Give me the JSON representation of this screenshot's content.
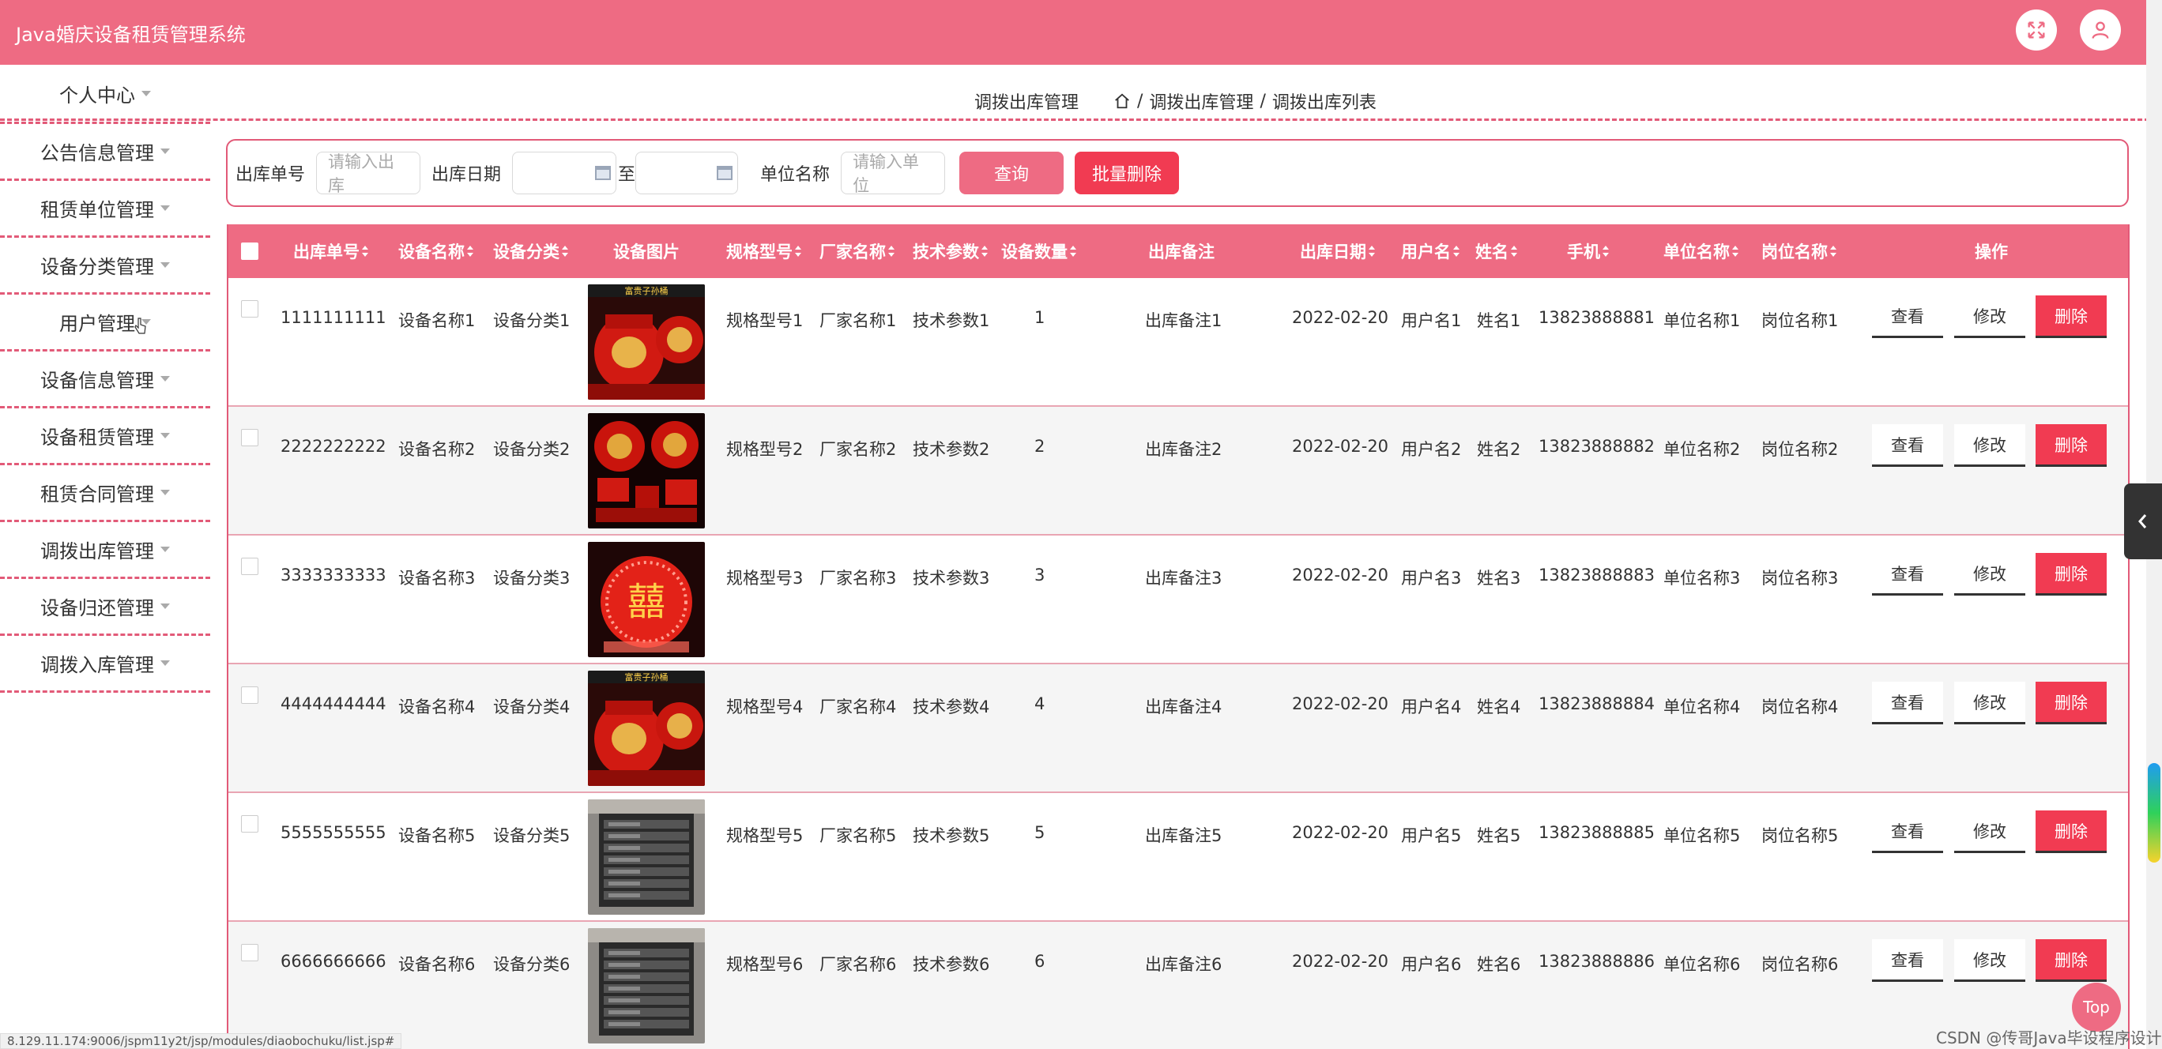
{
  "app": {
    "title": "Java婚庆设备租赁管理系统"
  },
  "sidebar": {
    "items": [
      {
        "label": "个人中心"
      },
      {
        "label": "公告信息管理"
      },
      {
        "label": "租赁单位管理"
      },
      {
        "label": "设备分类管理"
      },
      {
        "label": "用户管理"
      },
      {
        "label": "设备信息管理"
      },
      {
        "label": "设备租赁管理"
      },
      {
        "label": "租赁合同管理"
      },
      {
        "label": "调拨出库管理"
      },
      {
        "label": "设备归还管理"
      },
      {
        "label": "调拨入库管理"
      }
    ]
  },
  "breadcrumb": {
    "title": "调拨出库管理",
    "path": [
      "调拨出库管理",
      "调拨出库列表"
    ],
    "separator": "/"
  },
  "search": {
    "order_label": "出库单号",
    "order_placeholder": "请输入出库",
    "date_label": "出库日期",
    "date_to": "至",
    "unit_label": "单位名称",
    "unit_placeholder": "请输入单位",
    "query_button": "查询",
    "batch_delete_button": "批量删除"
  },
  "table": {
    "headers": {
      "order_no": "出库单号",
      "device_name": "设备名称",
      "device_category": "设备分类",
      "image": "设备图片",
      "spec": "规格型号",
      "manufacturer": "厂家名称",
      "tech_params": "技术参数",
      "quantity": "设备数量",
      "remark": "出库备注",
      "date": "出库日期",
      "username": "用户名",
      "name": "姓名",
      "phone": "手机",
      "unit": "单位名称",
      "position": "岗位名称",
      "actions": "操作"
    },
    "action_labels": {
      "view": "查看",
      "edit": "修改",
      "delete": "删除"
    },
    "rows": [
      {
        "order_no": "1111111111",
        "device_name": "设备名称1",
        "device_category": "设备分类1",
        "image_kind": "red-bucket",
        "image_caption": "富贵子孙桶",
        "spec": "规格型号1",
        "manufacturer": "厂家名称1",
        "tech_params": "技术参数1",
        "quantity": "1",
        "remark": "出库备注1",
        "date": "2022-02-20",
        "username": "用户名1",
        "name": "姓名1",
        "phone": "13823888881",
        "unit": "单位名称1",
        "position": "岗位名称1"
      },
      {
        "order_no": "2222222222",
        "device_name": "设备名称2",
        "device_category": "设备分类2",
        "image_kind": "red-set",
        "spec": "规格型号2",
        "manufacturer": "厂家名称2",
        "tech_params": "技术参数2",
        "quantity": "2",
        "remark": "出库备注2",
        "date": "2022-02-20",
        "username": "用户名2",
        "name": "姓名2",
        "phone": "13823888882",
        "unit": "单位名称2",
        "position": "岗位名称2"
      },
      {
        "order_no": "3333333333",
        "device_name": "设备名称3",
        "device_category": "设备分类3",
        "image_kind": "xi-lamp",
        "image_glyph": "囍",
        "spec": "规格型号3",
        "manufacturer": "厂家名称3",
        "tech_params": "技术参数3",
        "quantity": "3",
        "remark": "出库备注3",
        "date": "2022-02-20",
        "username": "用户名3",
        "name": "姓名3",
        "phone": "13823888883",
        "unit": "单位名称3",
        "position": "岗位名称3"
      },
      {
        "order_no": "4444444444",
        "device_name": "设备名称4",
        "device_category": "设备分类4",
        "image_kind": "red-bucket",
        "image_caption": "富贵子孙桶",
        "spec": "规格型号4",
        "manufacturer": "厂家名称4",
        "tech_params": "技术参数4",
        "quantity": "4",
        "remark": "出库备注4",
        "date": "2022-02-20",
        "username": "用户名4",
        "name": "姓名4",
        "phone": "13823888884",
        "unit": "单位名称4",
        "position": "岗位名称4"
      },
      {
        "order_no": "5555555555",
        "device_name": "设备名称5",
        "device_category": "设备分类5",
        "image_kind": "rack",
        "spec": "规格型号5",
        "manufacturer": "厂家名称5",
        "tech_params": "技术参数5",
        "quantity": "5",
        "remark": "出库备注5",
        "date": "2022-02-20",
        "username": "用户名5",
        "name": "姓名5",
        "phone": "13823888885",
        "unit": "单位名称5",
        "position": "岗位名称5"
      },
      {
        "order_no": "6666666666",
        "device_name": "设备名称6",
        "device_category": "设备分类6",
        "image_kind": "rack",
        "spec": "规格型号6",
        "manufacturer": "厂家名称6",
        "tech_params": "技术参数6",
        "quantity": "6",
        "remark": "出库备注6",
        "date": "2022-02-20",
        "username": "用户名6",
        "name": "姓名6",
        "phone": "13823888886",
        "unit": "单位名称6",
        "position": "岗位名称6"
      }
    ]
  },
  "footer": {
    "top_button": "Top",
    "status_url": "8.129.11.174:9006/jspm11y2t/jsp/modules/diaobochuku/list.jsp#",
    "watermark": "CSDN @传哥Java毕设程序设计"
  },
  "icons": {
    "fullscreen": "fullscreen-icon",
    "user": "user-icon",
    "home": "home-icon",
    "collapse": "chevron-left-icon"
  },
  "colors": {
    "primary": "#ee6b83",
    "danger": "#f13b52",
    "accent_border": "#e25a78"
  }
}
